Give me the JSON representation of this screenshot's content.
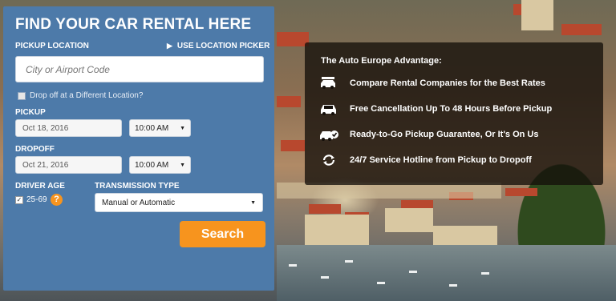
{
  "form": {
    "title": "FIND YOUR CAR RENTAL HERE",
    "pickup_location_label": "PICKUP LOCATION",
    "location_picker_label": "USE LOCATION PICKER",
    "city_placeholder": "City or Airport Code",
    "dropoff_different_label": "Drop off at a Different Location?",
    "pickup_label": "PICKUP",
    "pickup_date": "Oct 18, 2016",
    "pickup_time": "10:00 AM",
    "dropoff_label": "DROPOFF",
    "dropoff_date": "Oct 21, 2016",
    "dropoff_time": "10:00 AM",
    "driver_age_label": "DRIVER AGE",
    "driver_age_value": "25-69",
    "help_symbol": "?",
    "transmission_label": "TRANSMISSION TYPE",
    "transmission_value": "Manual or Automatic",
    "search_label": "Search"
  },
  "advantage": {
    "title": "The Auto Europe Advantage:",
    "items": [
      {
        "icon": "car-compare-icon",
        "text": "Compare Rental Companies for the Best Rates"
      },
      {
        "icon": "car-icon",
        "text": "Free Cancellation Up To 48 Hours Before Pickup"
      },
      {
        "icon": "car-check-icon",
        "text": "Ready-to-Go Pickup Guarantee, Or It's On Us"
      },
      {
        "icon": "refresh-icon",
        "text": "24/7 Service Hotline from Pickup to Dropoff"
      }
    ]
  },
  "colors": {
    "panel": "#4d7aa9",
    "accent": "#f7941e",
    "overlay": "#140f0a"
  }
}
